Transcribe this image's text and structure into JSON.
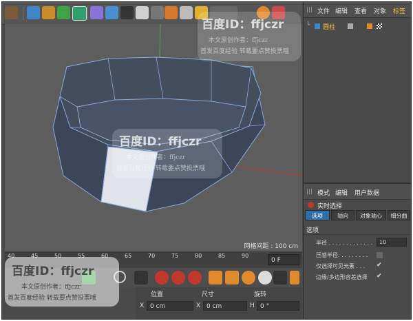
{
  "objects_panel": {
    "menu": [
      "文件",
      "编辑",
      "查看",
      "对象",
      "标签"
    ],
    "object_name": "圆柱"
  },
  "attributes_panel": {
    "menu": [
      "模式",
      "编辑",
      "用户数据"
    ],
    "mode_title": "实时选择",
    "tabs": [
      "选项",
      "轴向",
      "对象轴心",
      "细分曲"
    ],
    "section": "选项",
    "rows": [
      {
        "label": "半径 . . . . . . . . . . . . .",
        "value": "10"
      },
      {
        "label": "压感半径. . . . . . . . .",
        "value": ""
      },
      {
        "label": "仅选择可见元素 . . .",
        "value": "✔"
      },
      {
        "label": "边缘/多边形容差选择",
        "value": "✔"
      }
    ]
  },
  "viewport": {
    "grid_spacing": "网格间距 : 100 cm"
  },
  "timeline": {
    "ticks": [
      "40",
      "45",
      "50",
      "55",
      "60",
      "65",
      "70",
      "75",
      "80",
      "85",
      "90"
    ],
    "current_frame": "0 F"
  },
  "coordinates": {
    "headers": [
      "位置",
      "尺寸",
      "旋转"
    ],
    "row_x": {
      "axis": "X",
      "position": "0 cm",
      "size": "0 cm",
      "rot_axis": "H",
      "rotation": "0 °"
    }
  },
  "watermarks": {
    "baidu_id": "百度ID：ffjczr",
    "author": "本文原创作者：ffjczr",
    "notice": "首发百度经验  转载要点赞投票哦"
  },
  "colors": {
    "selection_tab": "#2f6ea8",
    "model_face": "#3f4f63",
    "model_edge": "#7fa8e0",
    "selected_face": "#dfe3ea"
  }
}
